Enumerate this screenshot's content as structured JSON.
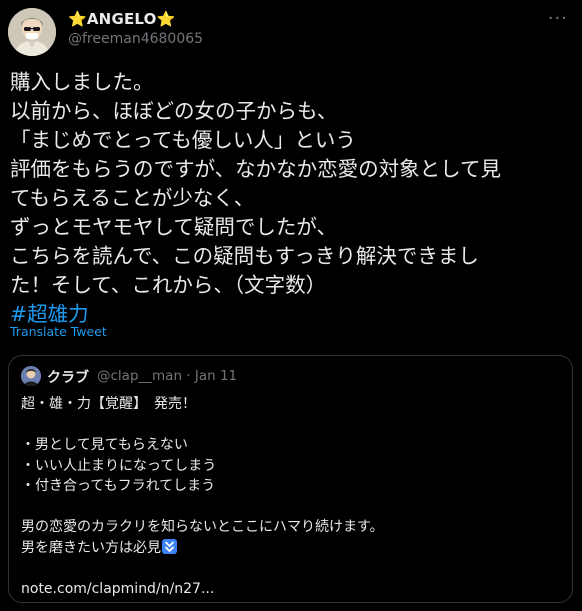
{
  "tweet": {
    "display_name": "⭐ANGELO⭐",
    "handle": "@freeman4680065",
    "more_icon": "more-horizontal-icon",
    "lines": [
      "購入しました。",
      "以前から、ほぼどの女の子からも、",
      "「まじめでとっても優しい人」という",
      "評価をもらうのですが、なかなか恋愛の対象として見",
      "てもらえることが少なく、",
      "ずっとモヤモヤして疑問でしたが、",
      "こちらを読んで、この疑問もすっきり解決できまし",
      "た！そして、これから、（文字数）"
    ],
    "hashtag": "#超雄力",
    "translate_label": "Translate Tweet"
  },
  "quote": {
    "display_name": "クラブ",
    "meta": "@clap__man · Jan 11",
    "lines": [
      "超・雄・力【覚醒】　発売！",
      "",
      "・男として見てもらえない",
      "・いい人止まりになってしまう",
      "・付き合ってもフラれてしまう",
      "",
      "男の恋愛のカラクリを知らないとここにハマり続けます。",
      "男を磨きたい方は必見"
    ],
    "link_text": "note.com/clapmind/n/n27...",
    "emoji_icon": "double-down-arrow-icon"
  },
  "colors": {
    "background": "#000000",
    "text": "#e7e9ea",
    "muted": "#71767b",
    "link": "#1d9bf0",
    "border": "#2f3336"
  }
}
